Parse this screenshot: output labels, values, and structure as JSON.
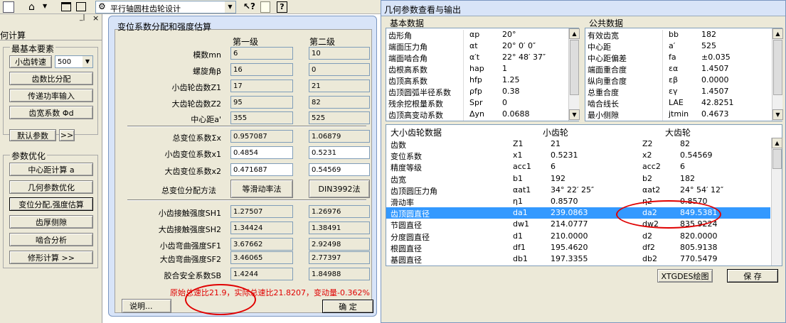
{
  "toolbar": {
    "combo_value": "平行轴圆柱齿轮设计",
    "icons": [
      "document-icon",
      "home-icon",
      "window-icon",
      "tile-icon",
      "gear-icon",
      "help-arrow-icon",
      "note-icon",
      "help-icon"
    ]
  },
  "left_panel": {
    "title": "何计算",
    "close": "×",
    "group1": "最基本要素",
    "speed_label": "小齿转速",
    "speed_value": "500",
    "buttons": [
      "齿数比分配",
      "传递功率输入",
      "齿宽系数 Φd"
    ],
    "default_btn": "默认参数",
    "more_btn": ">>",
    "group2": "参数优化",
    "opt_buttons": [
      "中心距计算 a",
      "几何参数优化",
      "变位分配,强度估算",
      "齿厚侧隙",
      "啮合分析",
      "修形计算   >>"
    ]
  },
  "middle": {
    "title": "变位系数分配和强度估算",
    "col1": "第一级",
    "col2": "第二级",
    "rows": [
      {
        "label": "模数mn",
        "v1": "6",
        "v2": "10"
      },
      {
        "label": "螺旋角β",
        "v1": "16",
        "v2": "0"
      },
      {
        "label": "小齿轮齿数Z1",
        "v1": "17",
        "v2": "21"
      },
      {
        "label": "大齿轮齿数Z2",
        "v1": "95",
        "v2": "82"
      },
      {
        "label": "中心距a'",
        "v1": "355",
        "v2": "525"
      }
    ],
    "rows2": [
      {
        "label": "总变位系数Σx",
        "v1": "0.957087",
        "v2": "1.06879"
      },
      {
        "label": "小齿变位系数x1",
        "v1": "0.4854",
        "v2": "0.5231"
      },
      {
        "label": "大齿变位系数x2",
        "v1": "0.471687",
        "v2": "0.54569"
      }
    ],
    "method_label": "总变位分配方法",
    "method_btn1": "等滑动率法",
    "method_btn2": "DIN3992法",
    "rows3": [
      {
        "label": "小齿接触强度SH1",
        "v1": "1.27507",
        "v2": "1.26976"
      },
      {
        "label": "大齿接触强度SH2",
        "v1": "1.34424",
        "v2": "1.38491"
      },
      {
        "label": "小齿弯曲强度SF1",
        "v1": "3.67662",
        "v2": "2.92498"
      },
      {
        "label": "大齿弯曲强度SF2",
        "v1": "3.46065",
        "v2": "2.77397"
      },
      {
        "label": "胶合安全系数SB",
        "v1": "1.4244",
        "v2": "1.84988"
      }
    ],
    "status": "原始总速比21.9，实际总速比21.8207，变动量-0.362%",
    "explain_btn": "说明...",
    "ok_btn": "确 定"
  },
  "right": {
    "title": "几何参数查看与输出",
    "basic_title": "基本数据",
    "basic_rows": [
      [
        "齿形角",
        "αp",
        "20°"
      ],
      [
        "端面压力角",
        "αt",
        "20° 0′ 0″"
      ],
      [
        "端面啮合角",
        "α′t",
        "22° 48′ 37″"
      ],
      [
        "齿根高系数",
        "hap",
        "1"
      ],
      [
        "齿顶高系数",
        "hfp",
        "1.25"
      ],
      [
        "齿顶圆弧半径系数",
        "ρfp",
        "0.38"
      ],
      [
        "残余挖根量系数",
        "Spr",
        "0"
      ],
      [
        "齿顶高变动系数",
        "Δyn",
        "0.0688"
      ]
    ],
    "common_title": "公共数据",
    "common_rows": [
      [
        "有效齿宽",
        "bb",
        "182"
      ],
      [
        "中心距",
        "a′",
        "525"
      ],
      [
        "中心距偏差",
        "fa",
        "±0.035"
      ],
      [
        "端面重合度",
        "εα",
        "1.4507"
      ],
      [
        "纵向重合度",
        "εβ",
        "0.0000"
      ],
      [
        "总重合度",
        "εγ",
        "1.4507"
      ],
      [
        "啮合线长",
        "LAE",
        "42.8251"
      ],
      [
        "最小侧隙",
        "jtmin",
        "0.4673"
      ]
    ],
    "gear_headers": [
      "大小齿轮数据",
      "小齿轮",
      "大齿轮"
    ],
    "gear_rows": [
      [
        "齿数",
        "Z1",
        "21",
        "Z2",
        "82"
      ],
      [
        "变位系数",
        "x1",
        "0.5231",
        "x2",
        "0.54569"
      ],
      [
        "精度等级",
        "acc1",
        "6",
        "acc2",
        "6"
      ],
      [
        "齿宽",
        "b1",
        "192",
        "b2",
        "182"
      ],
      [
        "齿顶圆压力角",
        "αat1",
        "34° 22′ 25″",
        "αat2",
        "24° 54′ 12″"
      ],
      [
        "滑动率",
        "η1",
        "0.8570",
        "η2",
        "0.8570"
      ],
      [
        "齿顶圆直径",
        "da1",
        "239.0863",
        "da2",
        "849.5381"
      ],
      [
        "节圆直径",
        "dw1",
        "214.0777",
        "dw2",
        "835.9224"
      ],
      [
        "分度圆直径",
        "d1",
        "210.0000",
        "d2",
        "820.0000"
      ],
      [
        "根圆直径",
        "df1",
        "195.4620",
        "df2",
        "805.9138"
      ],
      [
        "基圆直径",
        "db1",
        "197.3355",
        "db2",
        "770.5479"
      ]
    ],
    "draw_btn": "XTGDES绘图",
    "save_btn": "保 存"
  }
}
